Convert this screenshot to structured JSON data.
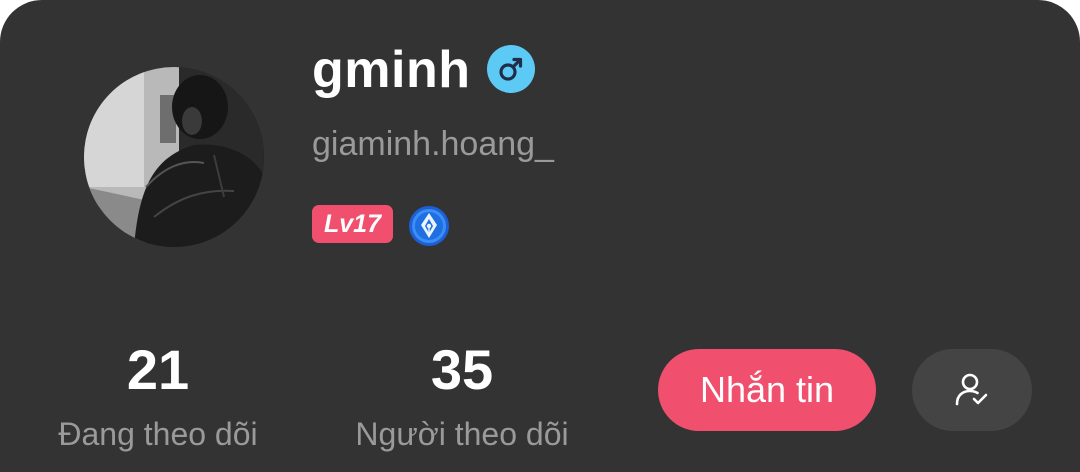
{
  "profile": {
    "username": "gminh",
    "handle": "giaminh.hoang_",
    "gender_icon": "male-icon",
    "level_badge": "Lv17",
    "pen_badge_icon": "fountain-pen-badge-icon",
    "avatar_icon": "avatar-photo"
  },
  "stats": {
    "following": {
      "value": "21",
      "label": "Đang theo dõi"
    },
    "followers": {
      "value": "35",
      "label": "Người theo dõi"
    }
  },
  "actions": {
    "message_label": "Nhắn tin",
    "follow_status_icon": "user-check-icon"
  },
  "colors": {
    "background": "#333333",
    "accent": "#f0506e",
    "gender_blue": "#5ccaf5",
    "muted_text": "#9a9a9a",
    "secondary_button": "#444444"
  }
}
